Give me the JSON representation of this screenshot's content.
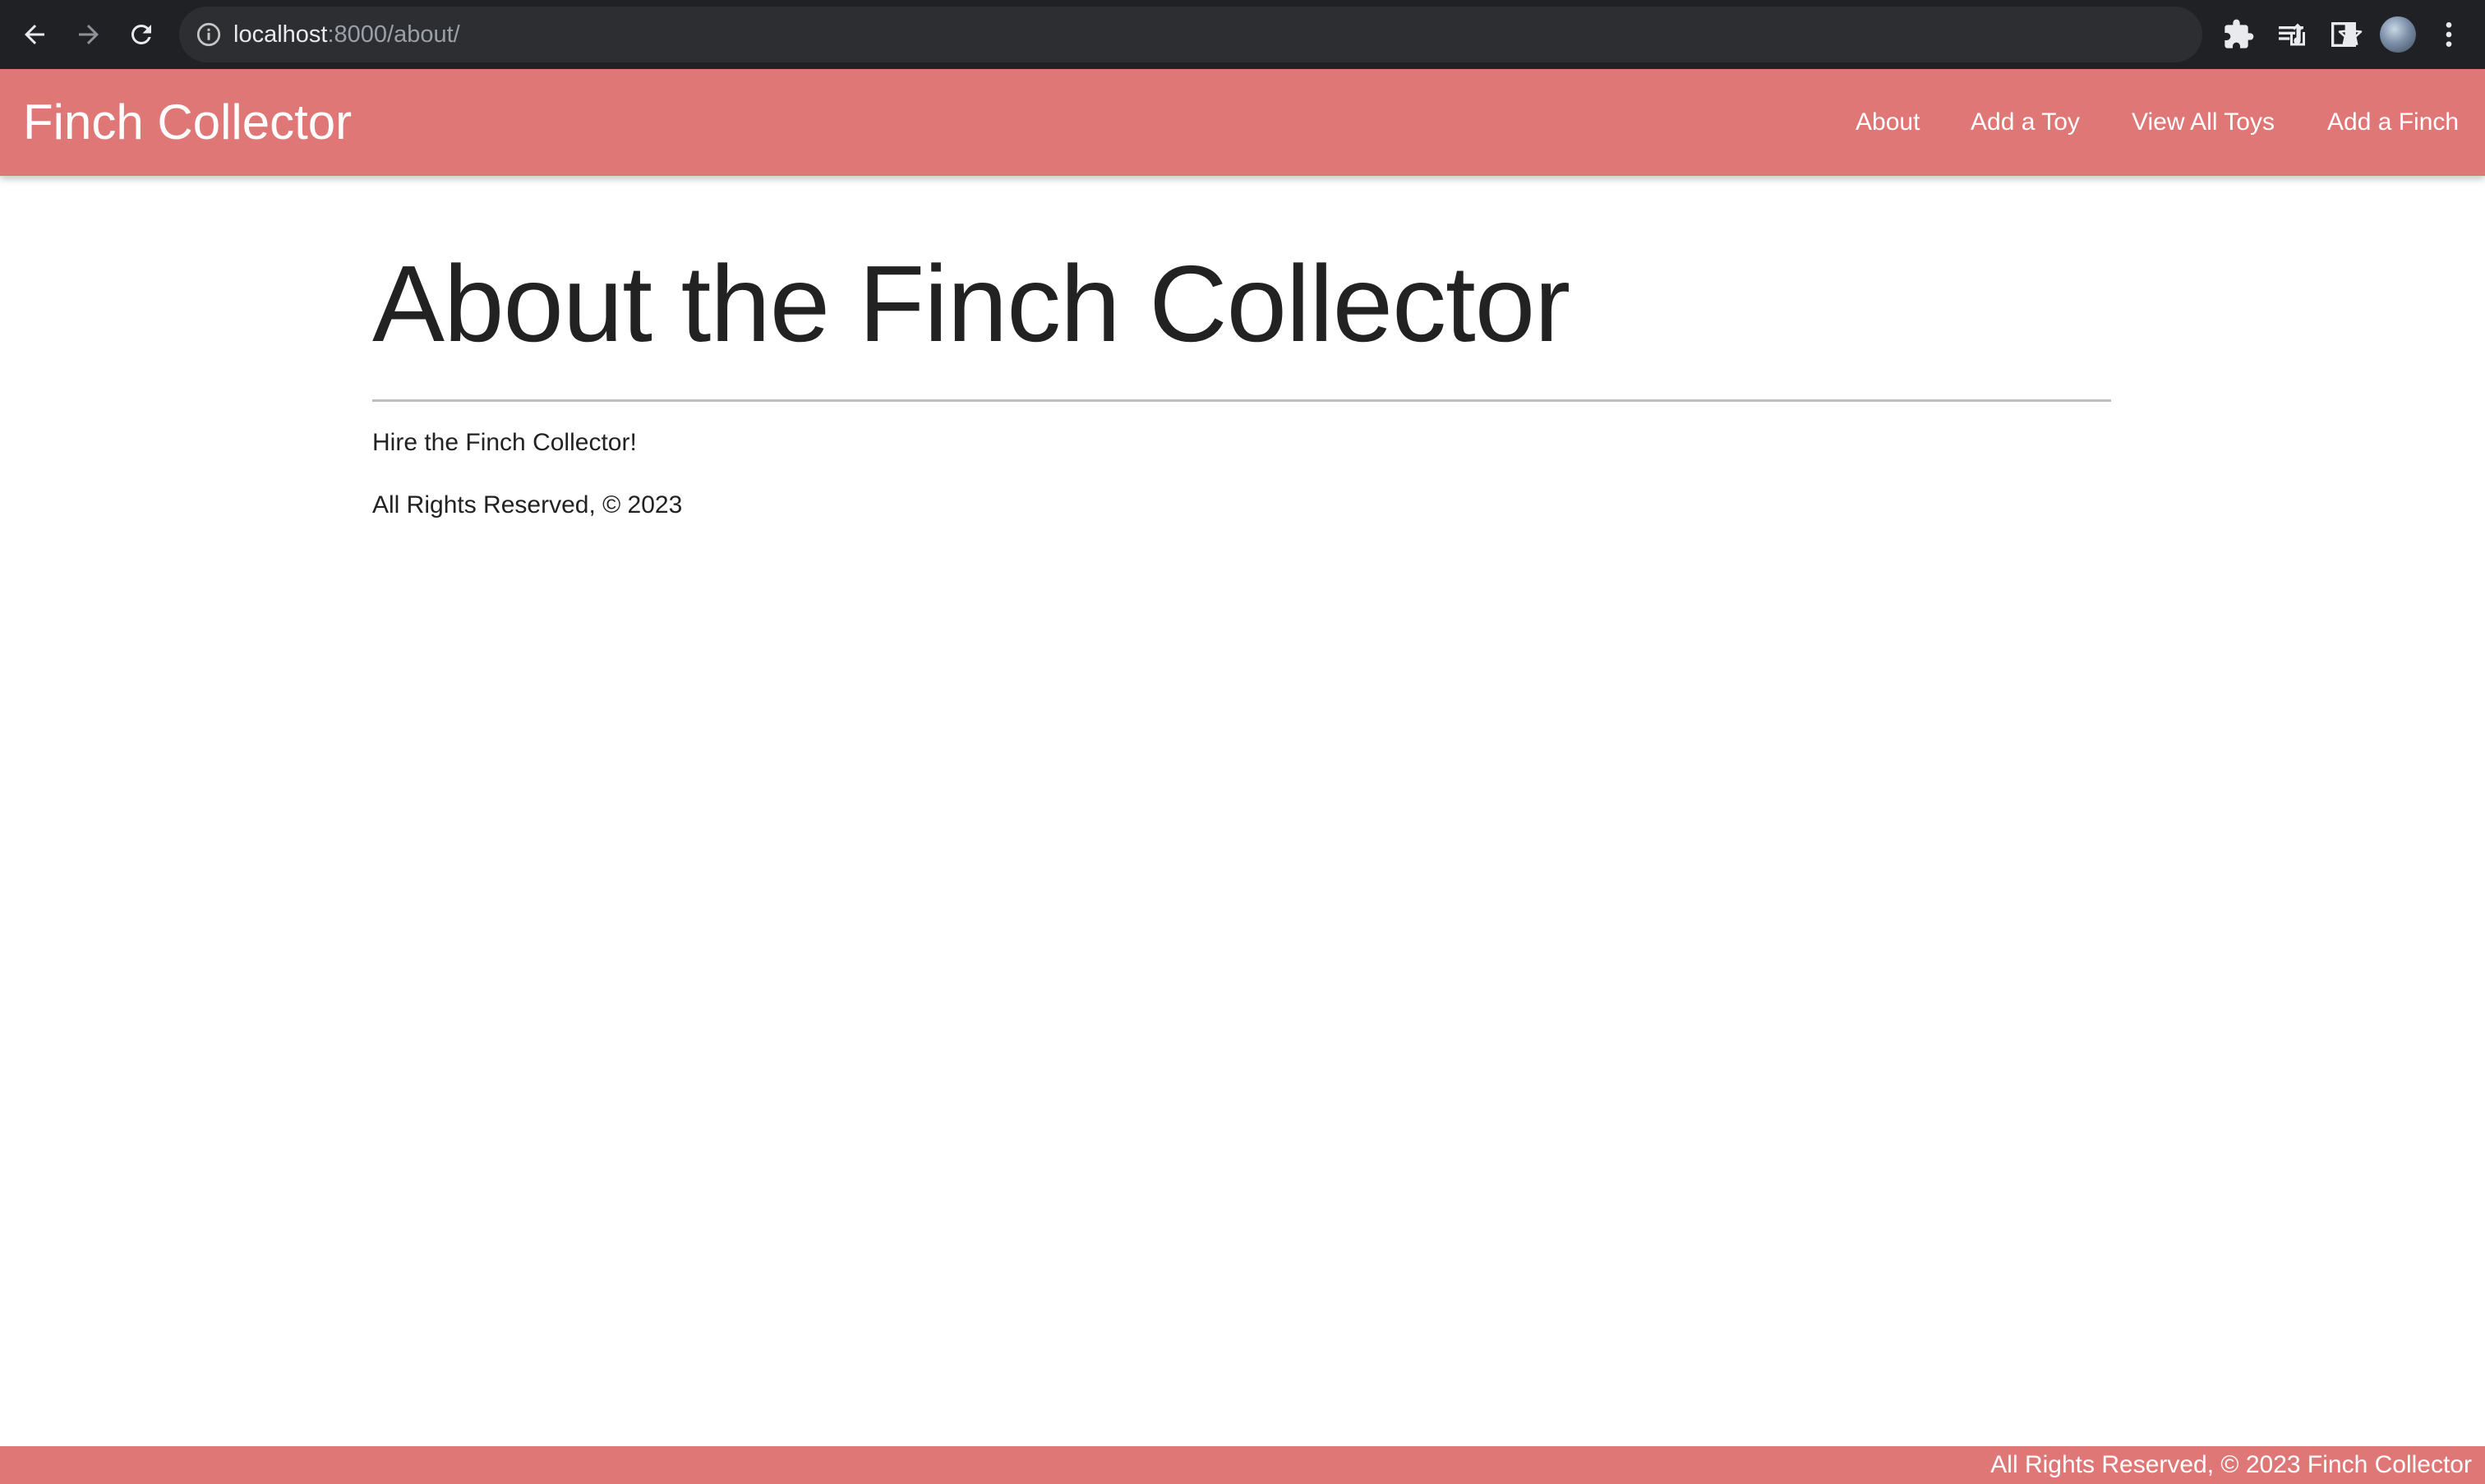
{
  "browser": {
    "url_host": "localhost",
    "url_rest": ":8000/about/"
  },
  "navbar": {
    "brand": "Finch Collector",
    "links": [
      "About",
      "Add a Toy",
      "View All Toys",
      "Add a Finch"
    ]
  },
  "main": {
    "title": "About the Finch Collector",
    "paragraphs": [
      "Hire the Finch Collector!",
      "All Rights Reserved, © 2023"
    ]
  },
  "footer": {
    "text": "All Rights Reserved, © 2023 Finch Collector"
  },
  "colors": {
    "accent": "#e07777",
    "chrome_bg": "#202124"
  }
}
